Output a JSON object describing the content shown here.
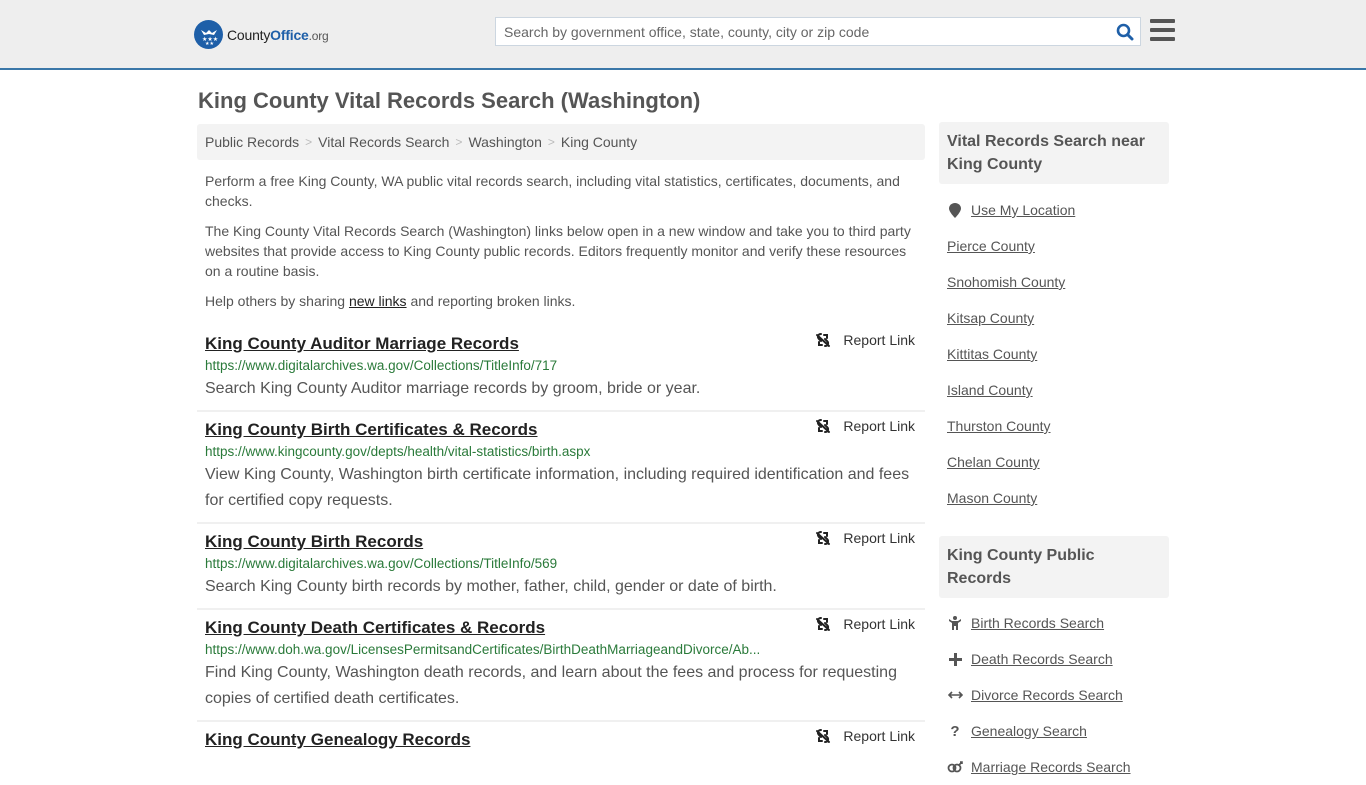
{
  "header": {
    "logo": {
      "name_part1": "County",
      "name_part2": "Office",
      "name_suffix": ".org"
    },
    "search": {
      "placeholder": "Search by government office, state, county, city or zip code",
      "value": ""
    },
    "colors": {
      "brand": "#1e5fa8",
      "topbar_bg": "#eeeeee",
      "accent_border": "#3a77a8"
    }
  },
  "page": {
    "title": "King County Vital Records Search (Washington)",
    "breadcrumb": [
      "Public Records",
      "Vital Records Search",
      "Washington",
      "King County"
    ],
    "breadcrumb_separator": ">",
    "intro": {
      "p1": "Perform a free King County, WA public vital records search, including vital statistics, certificates, documents, and checks.",
      "p2": "The King County Vital Records Search (Washington) links below open in a new window and take you to third party websites that provide access to King County public records. Editors frequently monitor and verify these resources on a routine basis.",
      "p3_before": "Help others by sharing ",
      "p3_link": "new links",
      "p3_after": " and reporting broken links."
    }
  },
  "results": [
    {
      "title": "King County Auditor Marriage Records",
      "url": "https://www.digitalarchives.wa.gov/Collections/TitleInfo/717",
      "description": "Search King County Auditor marriage records by groom, bride or year.",
      "report_label": "Report Link"
    },
    {
      "title": "King County Birth Certificates & Records",
      "url": "https://www.kingcounty.gov/depts/health/vital-statistics/birth.aspx",
      "description": "View King County, Washington birth certificate information, including required identification and fees for certified copy requests.",
      "report_label": "Report Link"
    },
    {
      "title": "King County Birth Records",
      "url": "https://www.digitalarchives.wa.gov/Collections/TitleInfo/569",
      "description": "Search King County birth records by mother, father, child, gender or date of birth.",
      "report_label": "Report Link"
    },
    {
      "title": "King County Death Certificates & Records",
      "url": "https://www.doh.wa.gov/LicensesPermitsandCertificates/BirthDeathMarriageandDivorce/Ab...",
      "description": "Find King County, Washington death records, and learn about the fees and process for requesting copies of certified death certificates.",
      "report_label": "Report Link"
    },
    {
      "title": "King County Genealogy Records",
      "url": "",
      "description": "",
      "report_label": "Report Link"
    }
  ],
  "sidebar": {
    "nearby": {
      "heading": "Vital Records Search near King County",
      "use_location": {
        "label": "Use My Location",
        "icon": "map-marker-icon"
      },
      "items": [
        "Pierce County",
        "Snohomish County",
        "Kitsap County",
        "Kittitas County",
        "Island County",
        "Thurston County",
        "Chelan County",
        "Mason County"
      ]
    },
    "public_records": {
      "heading": "King County Public Records",
      "items": [
        {
          "label": "Birth Records Search",
          "icon": "child-icon"
        },
        {
          "label": "Death Records Search",
          "icon": "plus-icon"
        },
        {
          "label": "Divorce Records Search",
          "icon": "left-right-arrow-icon"
        },
        {
          "label": "Genealogy Search",
          "icon": "question-icon"
        },
        {
          "label": "Marriage Records Search",
          "icon": "marriage-symbol-icon"
        }
      ]
    }
  }
}
